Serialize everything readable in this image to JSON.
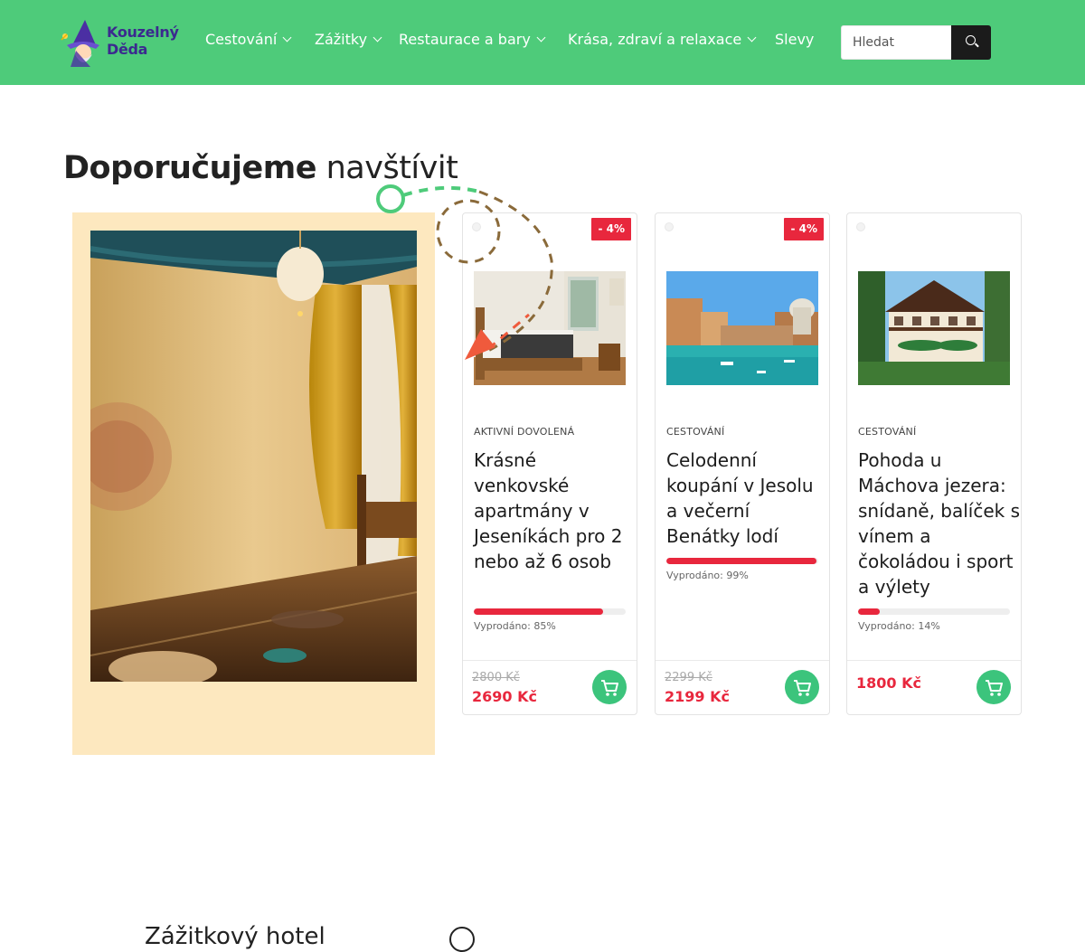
{
  "header": {
    "logo_line1": "Kouzelný",
    "logo_line2": "Děda",
    "nav": [
      {
        "label": "Cestování",
        "has_dropdown": true
      },
      {
        "label": "Zážitky",
        "has_dropdown": true
      },
      {
        "label": "Restaurace a bary",
        "has_dropdown": true
      },
      {
        "label": "Krása, zdraví a relaxace",
        "has_dropdown": true
      },
      {
        "label": "Slevy",
        "has_dropdown": false
      }
    ],
    "search": {
      "placeholder": "Hledat",
      "value": "",
      "icon": "search-icon"
    }
  },
  "section": {
    "title_bold": "Doporučujeme",
    "title_light": "navštívit"
  },
  "featured": {
    "title": "Zážitkový hotel"
  },
  "products": [
    {
      "discount": "- 4%",
      "category": "AKTIVNÍ DOVOLENÁ",
      "title": "Krásné venkovské apartmány v Jeseníkách pro 2 nebo až 6 osob",
      "sold_label": "Vyprodáno: 85%",
      "sold_fraction": 0.85,
      "old_price": "2800 Kč",
      "price": "2690 Kč"
    },
    {
      "discount": "- 4%",
      "category": "CESTOVÁNÍ",
      "title": "Celodenní koupání v Jesolu a večerní Benátky lodí",
      "sold_label": "Vyprodáno: 99%",
      "sold_fraction": 0.99,
      "old_price": "2299 Kč",
      "price": "2199 Kč"
    },
    {
      "discount": "",
      "category": "CESTOVÁNÍ",
      "title": "Pohoda u Máchova jezera: snídaně, balíček s vínem a čokoládou i sport a výlety",
      "sold_label": "Vyprodáno: 14%",
      "sold_fraction": 0.14,
      "old_price": "",
      "price": "1800 Kč"
    }
  ],
  "colors": {
    "header_bg": "#4ecb7a",
    "accent_red": "#e8273d",
    "cart_green": "#3cc47c",
    "featured_bg": "#fde8bf"
  }
}
